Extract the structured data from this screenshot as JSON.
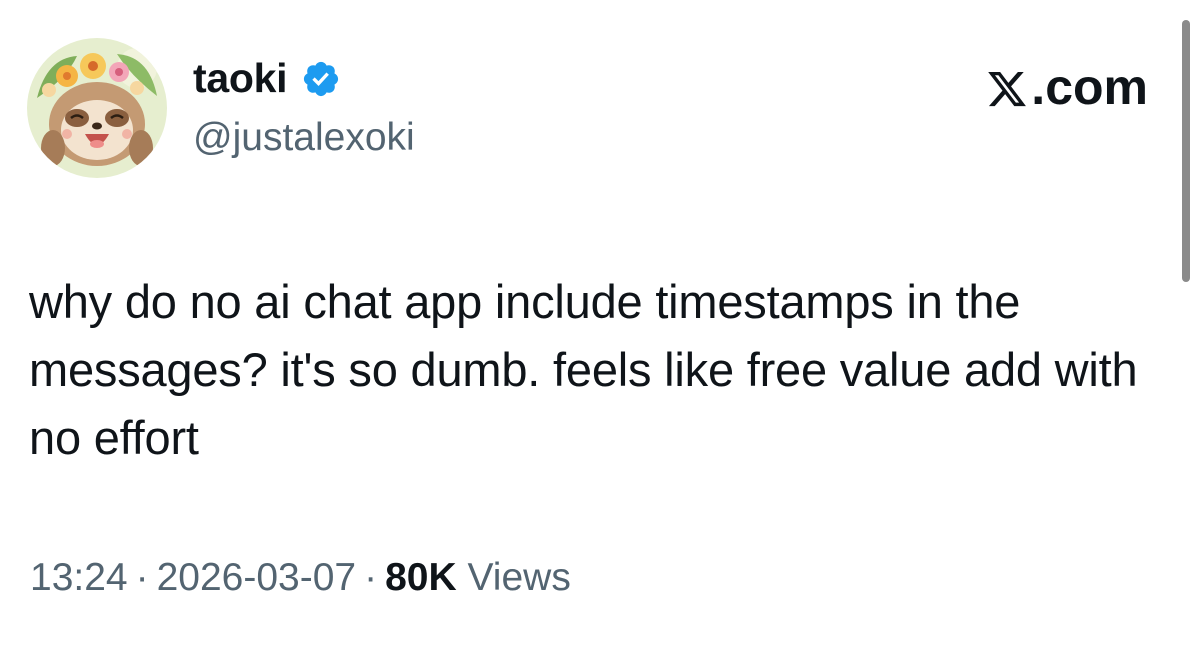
{
  "author": {
    "display_name": "taoki",
    "handle": "@justalexoki",
    "verified": true,
    "avatar_icon": "sloth-flower-crown-avatar"
  },
  "brand": {
    "label": ".com",
    "icon": "x-logo-icon"
  },
  "tweet": {
    "text": "why do no ai chat app include timestamps in the messages? it's so dumb. feels like free value add with no effort"
  },
  "meta": {
    "time": "13:24",
    "separator": "·",
    "date": "2026-03-07",
    "views_count": "80K",
    "views_label": "Views"
  },
  "colors": {
    "text_primary": "#0f1419",
    "text_secondary": "#536471",
    "verified_badge": "#1d9bf0"
  }
}
